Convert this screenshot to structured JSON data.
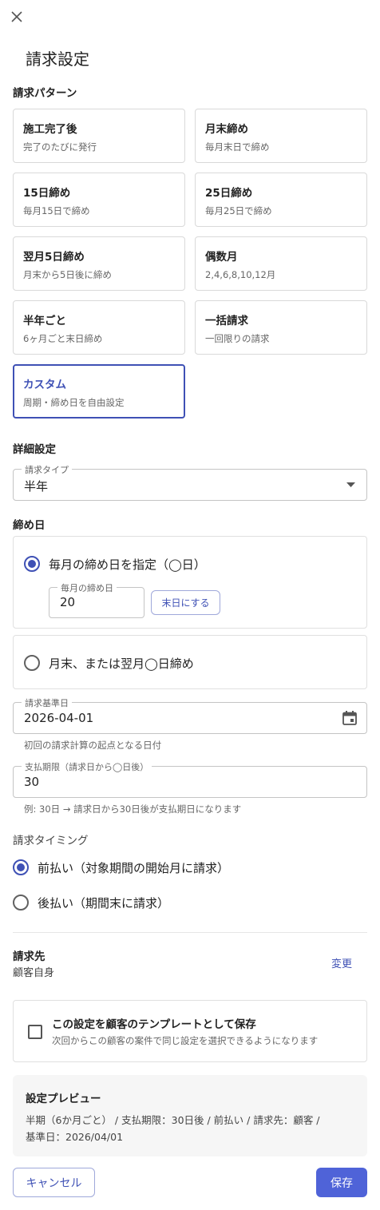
{
  "page_title": "請求設定",
  "pattern_section": {
    "heading": "請求パターン",
    "items": [
      {
        "title": "施工完了後",
        "desc": "完了のたびに発行",
        "selected": false
      },
      {
        "title": "月末締め",
        "desc": "毎月末日で締め",
        "selected": false
      },
      {
        "title": "15日締め",
        "desc": "毎月15日で締め",
        "selected": false
      },
      {
        "title": "25日締め",
        "desc": "毎月25日で締め",
        "selected": false
      },
      {
        "title": "翌月5日締め",
        "desc": "月末から5日後に締め",
        "selected": false
      },
      {
        "title": "偶数月",
        "desc": "2,4,6,8,10,12月",
        "selected": false
      },
      {
        "title": "半年ごと",
        "desc": "6ヶ月ごと末日締め",
        "selected": false
      },
      {
        "title": "一括請求",
        "desc": "一回限りの請求",
        "selected": false
      },
      {
        "title": "カスタム",
        "desc": "周期・締め日を自由設定",
        "selected": true
      }
    ]
  },
  "detail": {
    "heading": "詳細設定",
    "type_label": "請求タイプ",
    "type_value": "半年"
  },
  "closing": {
    "heading": "締め日",
    "option1_label": "毎月の締め日を指定（◯日）",
    "day_label": "毎月の締め日",
    "day_value": "20",
    "end_of_month_button": "末日にする",
    "option2_label": "月末、または翌月◯日締め"
  },
  "base_date": {
    "label": "請求基準日",
    "value": "2026-04-01",
    "helper": "初回の請求計算の起点となる日付"
  },
  "payment_term": {
    "label": "支払期限（請求日から◯日後）",
    "value": "30",
    "helper": "例: 30日 → 請求日から30日後が支払期日になります"
  },
  "timing": {
    "heading": "請求タイミング",
    "option1": "前払い（対象期間の開始月に請求）",
    "option2": "後払い（期間末に請求）"
  },
  "billing_to": {
    "heading": "請求先",
    "value": "顧客自身",
    "change_link": "変更"
  },
  "template": {
    "title": "この設定を顧客のテンプレートとして保存",
    "desc": "次回からこの顧客の案件で同じ設定を選択できるようになります"
  },
  "preview": {
    "heading": "設定プレビュー",
    "line1": "半期（6か月ごと） / 支払期限：30日後 / 前払い / 請求先：顧客 /",
    "line2": "基準日：2026/04/01"
  },
  "footer": {
    "cancel": "キャンセル",
    "save": "保存"
  },
  "colors": {
    "accent": "#3f51b5",
    "primary_button": "#4f63d8"
  },
  "icons": [
    "close-icon",
    "dropdown-arrow-icon",
    "calendar-icon"
  ]
}
